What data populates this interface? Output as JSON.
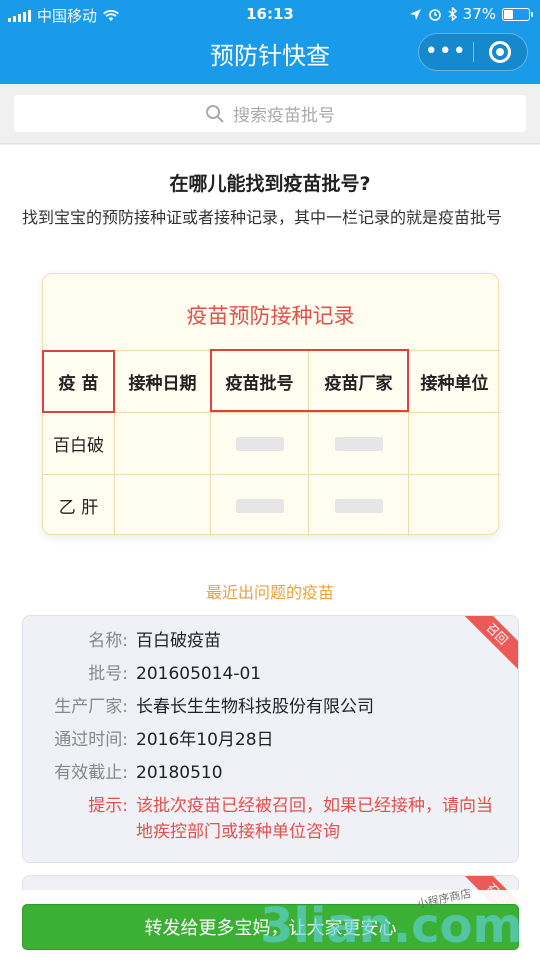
{
  "status_bar": {
    "carrier": "中国移动",
    "time": "16:13",
    "battery": "37%",
    "battery_level": 0.37
  },
  "nav": {
    "title": "预防针快查",
    "more_icon": "more-dots-icon",
    "close_icon": "target-icon"
  },
  "search": {
    "placeholder": "搜索疫苗批号"
  },
  "guide": {
    "heading": "在哪儿能找到疫苗批号?",
    "description": "找到宝宝的预防接种证或者接种记录，其中一栏记录的就是疫苗批号"
  },
  "record": {
    "title": "疫苗预防接种记录",
    "columns": [
      "疫 苗",
      "接种日期",
      "疫苗批号",
      "疫苗厂家",
      "接种单位"
    ],
    "rows": [
      [
        "百白破"
      ],
      [
        "乙 肝"
      ]
    ]
  },
  "recent_label": "最近出问题的疫苗",
  "vaccine_card": {
    "ribbon": "召回",
    "fields": [
      {
        "key": "名称:",
        "value": "百白破疫苗"
      },
      {
        "key": "批号:",
        "value": "201605014-01"
      },
      {
        "key": "生产厂家:",
        "value": "长春长生生物科技股份有限公司"
      },
      {
        "key": "通过时间:",
        "value": "2016年10月28日"
      },
      {
        "key": "有效截止:",
        "value": "20180510"
      }
    ],
    "warning": {
      "key": "提示:",
      "value": "该批次疫苗已经被召回，如果已经接种，请向当地疾控部门或接种单位咨询"
    }
  },
  "vaccine_card_2": {
    "ribbon": "召回"
  },
  "share_button": "转发给更多宝妈，让大家更安心",
  "watermark": {
    "logo": "3lian.com",
    "small_text": "小程序商店"
  },
  "colors": {
    "brand": "#1a9bea",
    "alert": "#e2504b",
    "button": "#3cb035",
    "accent": "#e8a23c"
  }
}
